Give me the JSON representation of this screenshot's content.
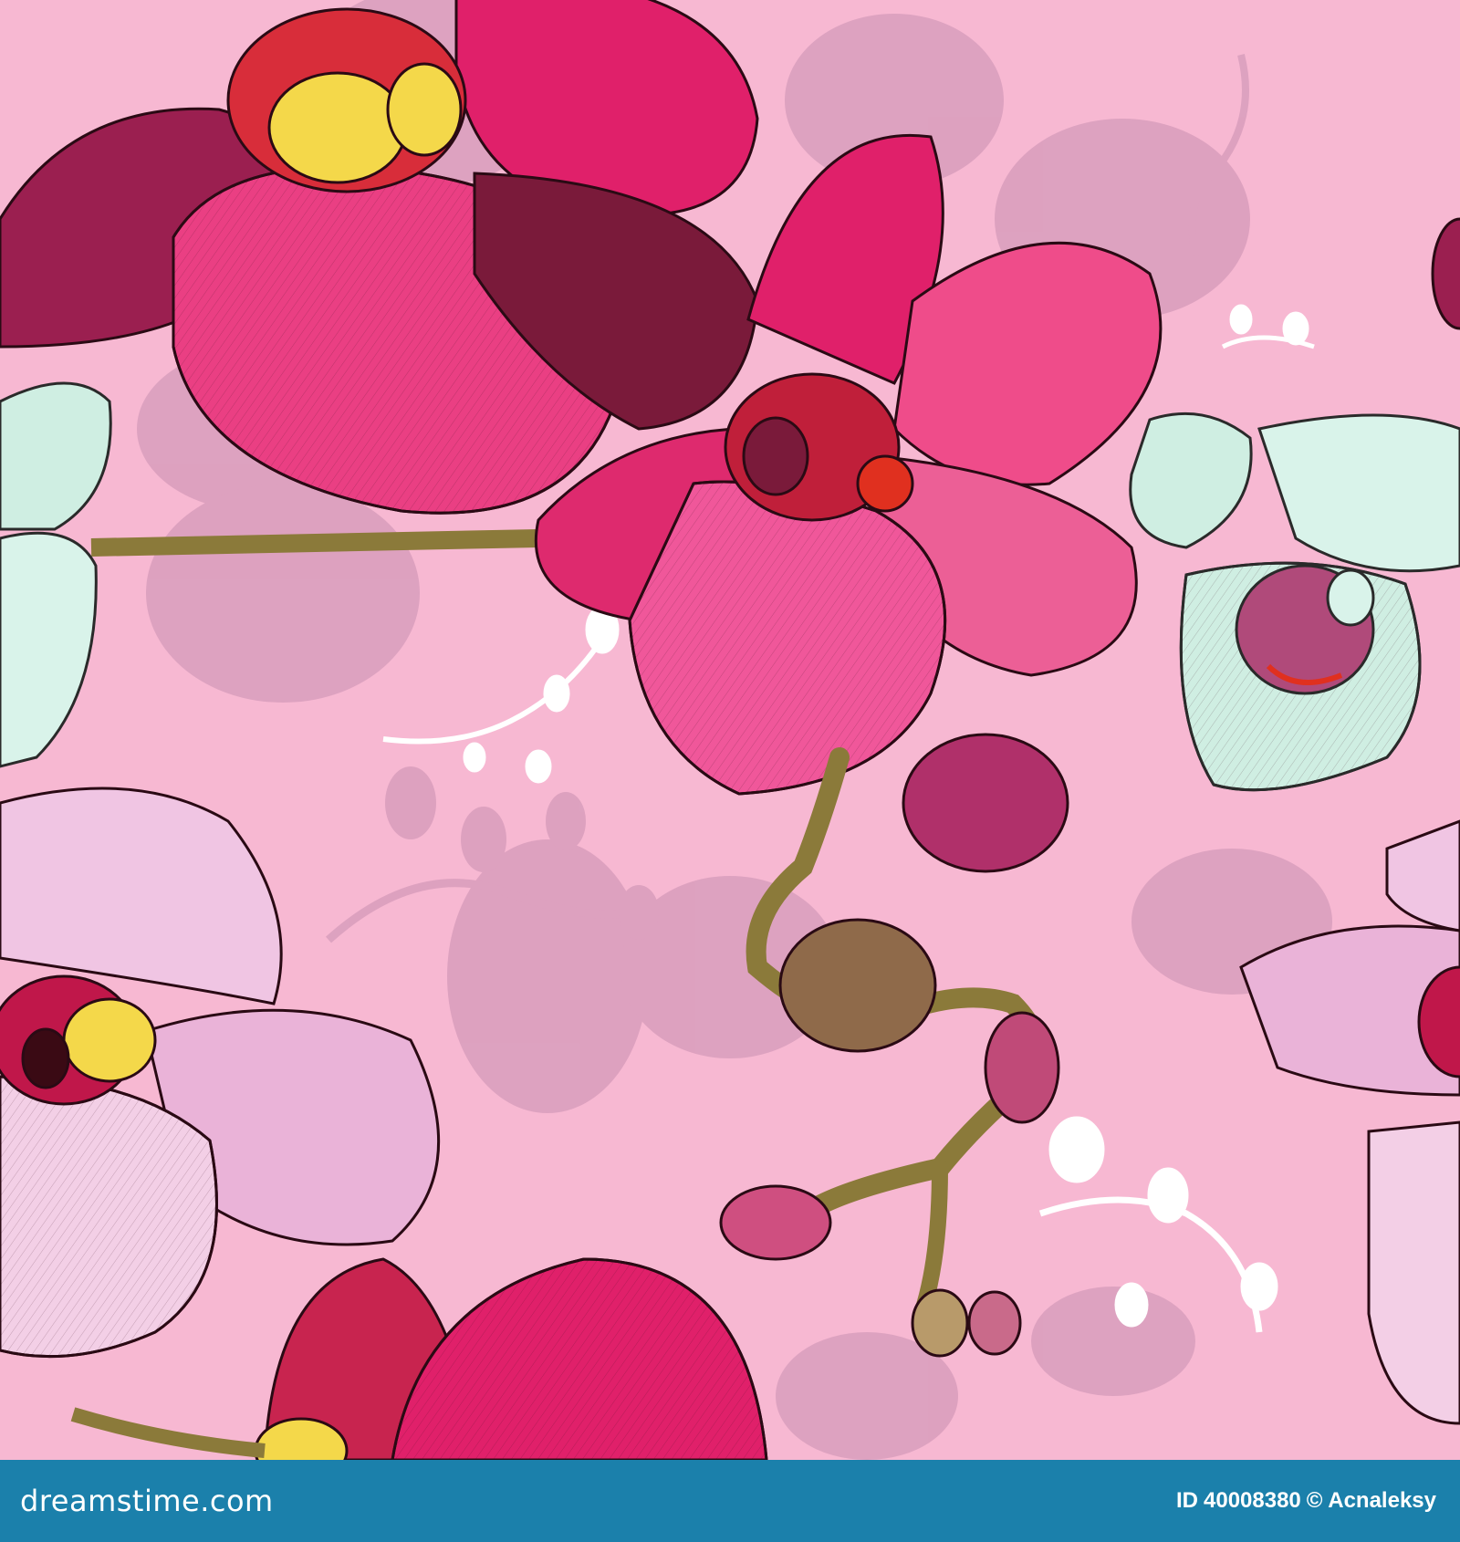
{
  "image": {
    "subject": "seamless floral pattern",
    "colors": {
      "background": "#f7b8d2",
      "magenta_petal": "#e0206a",
      "light_pink_petal": "#f0c5e3",
      "mint_petal": "#cfeee2",
      "stem": "#8b7a3a",
      "shadow": "#c98fb0",
      "footer": "#1b80ab"
    }
  },
  "footer": {
    "brand": "dreamstime.com",
    "id_label": "ID",
    "id_number": "40008380",
    "copyright": "© Acnaleksy"
  }
}
